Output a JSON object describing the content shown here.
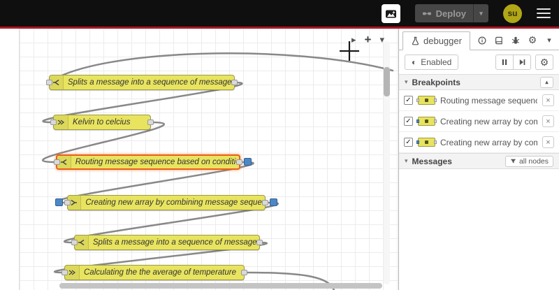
{
  "header": {
    "deploy_label": "Deploy",
    "user_initials": "su"
  },
  "canvas": {
    "nodes": [
      {
        "type": "split",
        "label": "Splits a message into a sequence of messages."
      },
      {
        "type": "function",
        "label": "Kelvin to celcius"
      },
      {
        "type": "switch",
        "label": "Routing message sequence based on condition",
        "selected": true,
        "breakpoint": "output"
      },
      {
        "type": "join",
        "label": "Creating new array by combining message sequence",
        "breakpoint": "both"
      },
      {
        "type": "split",
        "label": "Splits a message into a sequence of messages."
      },
      {
        "type": "function",
        "label": "Calculating the the average of temperature"
      }
    ]
  },
  "sidebar": {
    "active_tab": "debugger",
    "enabled_label": "Enabled",
    "breakpoints": {
      "title": "Breakpoints",
      "items": [
        {
          "label": "Routing message sequence ba"
        },
        {
          "label": "Creating new array by combini"
        },
        {
          "label": "Creating new array by combini"
        }
      ]
    },
    "messages": {
      "title": "Messages",
      "filter_label": "all nodes"
    }
  },
  "icons": {
    "play": "▸",
    "plus": "+",
    "chevron_down": "▾",
    "collapse": "▴",
    "gear": "⚙",
    "toggle": "◐",
    "check": "✓",
    "close": "×"
  },
  "colors": {
    "node_yellow": "#e8e45f",
    "selection_orange": "#eb5f18",
    "breakpoint_blue": "#4d87c7",
    "header_red": "#ad1625",
    "avatar_olive": "#b1a717"
  }
}
